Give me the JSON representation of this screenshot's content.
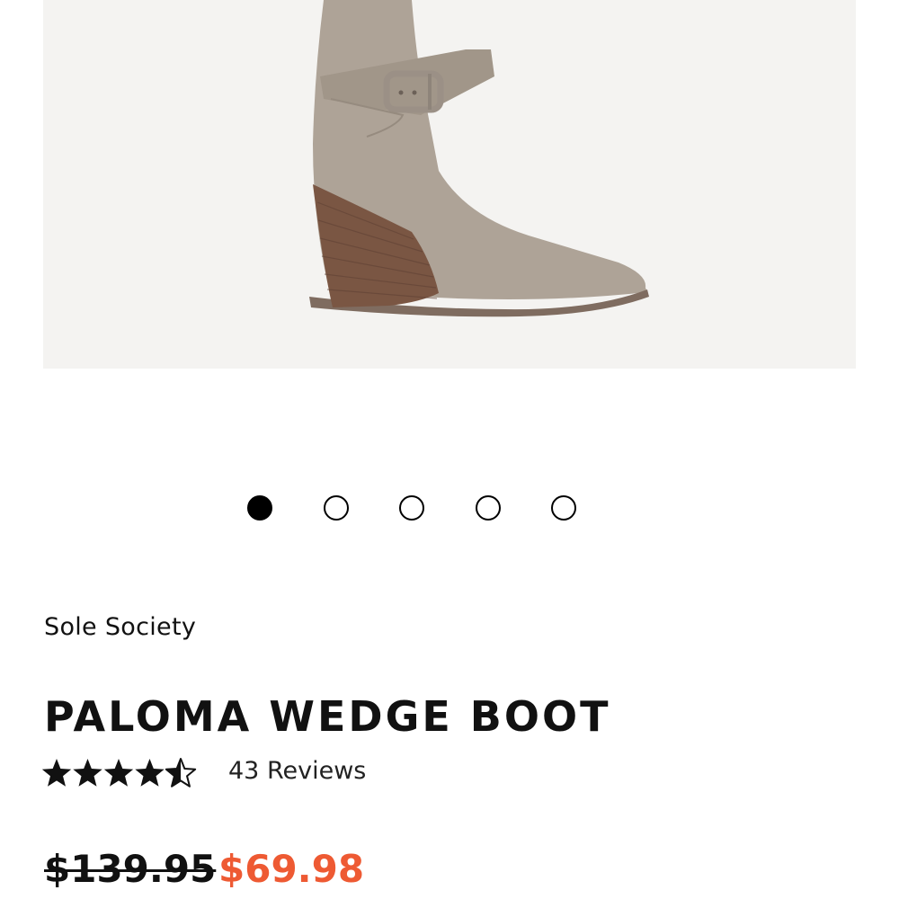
{
  "product": {
    "brand": "Sole Society",
    "title": "PALOMA WEDGE BOOT",
    "rating": 4.5,
    "rating_max": 5,
    "reviews_label": "43 Reviews",
    "original_price": "$139.95",
    "sale_price": "$69.98"
  },
  "carousel": {
    "total_slides": 5,
    "active_index": 0
  },
  "colors": {
    "sale_price": "#ee5a33",
    "text": "#111111",
    "image_background": "#f4f3f1",
    "boot_suede": "#aea397",
    "wedge_wood": "#7a5643"
  },
  "icons": {
    "star": "star-icon",
    "dot": "carousel-dot"
  }
}
